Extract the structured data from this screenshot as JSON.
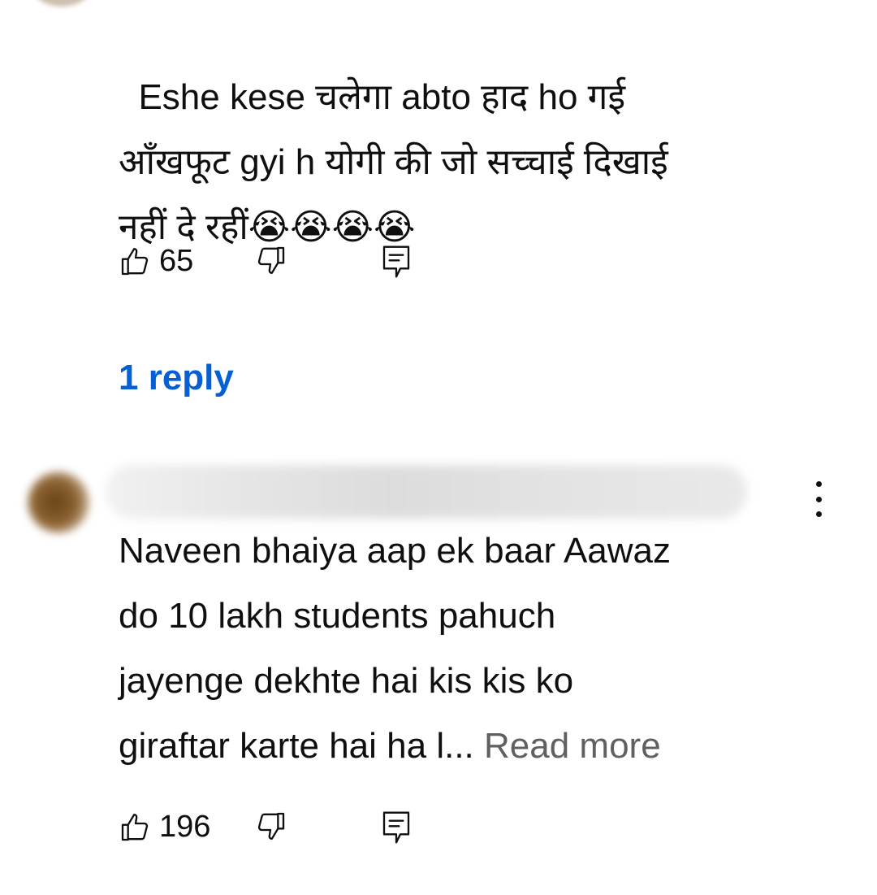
{
  "comments": [
    {
      "text": "Eshe kese चलेगा abto हाद ho गई\nआँखफूट gyi h योगी की जो सच्चाई दिखाई\nनहीं दे रहीं😭😭😭😭",
      "likes": "65",
      "reply_link": "1 reply"
    },
    {
      "text": "Naveen bhaiya aap ek baar Aawaz\ndo 10 lakh students pahuch\njayenge dekhte hai kis kis ko\ngiraftar karte hai ha l... ",
      "read_more": "Read more",
      "likes": "196"
    }
  ],
  "icons": {
    "like": "thumbs-up-icon",
    "dislike": "thumbs-down-icon",
    "reply": "reply-icon",
    "more": "more-vert-icon"
  },
  "colors": {
    "text": "#0f0f0f",
    "secondary": "#606060",
    "link": "#065fd4"
  }
}
